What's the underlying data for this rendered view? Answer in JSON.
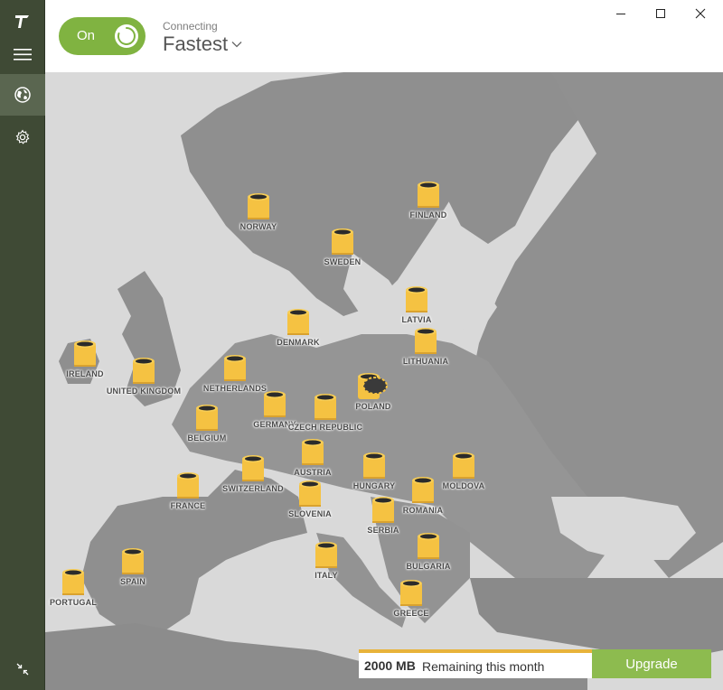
{
  "header": {
    "toggle_label": "On",
    "status_text": "Connecting",
    "location": "Fastest"
  },
  "sidebar": {
    "items": [
      {
        "icon": "tunnelbear-logo-icon"
      },
      {
        "icon": "menu-icon"
      },
      {
        "icon": "globe-icon",
        "active": true
      },
      {
        "icon": "gear-icon"
      },
      {
        "icon": "collapse-icon"
      }
    ]
  },
  "countries": [
    "NORWAY",
    "SWEDEN",
    "FINLAND",
    "DENMARK",
    "LATVIA",
    "LITHUANIA",
    "IRELAND",
    "UNITED KINGDOM",
    "NETHERLANDS",
    "GERMANY",
    "POLAND",
    "CZECH REPUBLIC",
    "BELGIUM",
    "AUSTRIA",
    "SWITZERLAND",
    "HUNGARY",
    "MOLDOVA",
    "FRANCE",
    "SLOVENIA",
    "ROMANIA",
    "SERBIA",
    "BULGARIA",
    "ITALY",
    "SPAIN",
    "PORTUGAL",
    "GREECE"
  ],
  "footer": {
    "data_amount": "2000 MB",
    "data_text": "Remaining this month",
    "upgrade_label": "Upgrade"
  },
  "colors": {
    "sidebar": "#3f4a35",
    "toggle_on": "#80b341",
    "upgrade": "#8dbb4f",
    "data_bar": "#e8b33a",
    "barrel": "#f5c242",
    "land": "#8f8f8f",
    "sea": "#d9d9d9"
  }
}
